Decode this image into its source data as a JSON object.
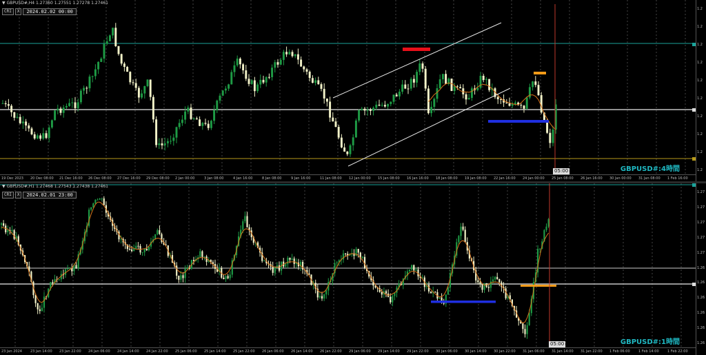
{
  "top": {
    "header": "GBPUSD#,H4  1.27360 1.27551 1.27278 1.27461",
    "dt_btn1": "CRI",
    "dt_btn2": "X",
    "datetime": "2024.02.02 00:00",
    "watermark": "GBPUSD#:4時間",
    "time_label": "05:00",
    "price_labels": [
      "1.2",
      "1.2",
      "1.2",
      "1.2",
      "1.2",
      "1.2",
      "1.2",
      "1.2",
      "1.2",
      "1.2"
    ],
    "time_axis": [
      "19 Dec 2023",
      "20 Dec 08:00",
      "21 Dec 16:00",
      "26 Dec 08:00",
      "27 Dec 16:00",
      "29 Dec 08:00",
      "2 Jan 00:00",
      "3 Jan 08:00",
      "4 Jan 16:00",
      "8 Jan 08:00",
      "9 Jan 16:00",
      "11 Jan 08:00",
      "12 Jan 00:00",
      "15 Jan 08:00",
      "16 Jan 16:00",
      "18 Jan 08:00",
      "19 Jan 08:00",
      "22 Jan 16:00",
      "24 Jan 00:00",
      "25 Jan 08:00",
      "26 Jan 16:00",
      "30 Jan 00:00",
      "31 Jan 08:00",
      "1 Feb 16:00"
    ]
  },
  "bottom": {
    "header": "GBPUSD#,H1  1.27468 1.27543 1.27438 1.27461",
    "dt_btn1": "CRI",
    "dt_btn2": "X",
    "datetime": "2024.02.01 23:00",
    "watermark": "GBPUSD#:1時間",
    "time_label": "05:00",
    "price_labels": [
      "1.27",
      "1.27",
      "1.27",
      "1.27",
      "1.27",
      "1.26",
      "1.26",
      "1.26",
      "1.26",
      "1.26",
      "1.26"
    ],
    "time_axis": [
      "23 Jan 2024",
      "23 Jan 14:00",
      "23 Jan 22:00",
      "24 Jan 06:00",
      "24 Jan 14:00",
      "24 Jan 22:00",
      "25 Jan 06:00",
      "25 Jan 14:00",
      "25 Jan 22:00",
      "26 Jan 06:00",
      "26 Jan 14:00",
      "26 Jan 22:00",
      "29 Jan 06:00",
      "29 Jan 14:00",
      "29 Jan 22:00",
      "30 Jan 06:00",
      "30 Jan 14:00",
      "30 Jan 22:00",
      "31 Jan 06:00",
      "31 Jan 14:00",
      "31 Jan 22:00",
      "1 Feb 06:00",
      "1 Feb 14:00",
      "1 Feb 22:00"
    ]
  },
  "colors": {
    "bull": "#1e9b45",
    "bear": "#f2f2c8",
    "ma": "#d8731a",
    "channel": "#e6e6e6",
    "cyan_line": "#1aa39a",
    "yellow_line": "#b79a1a",
    "red_zone": "#e8101a",
    "blue_zone": "#1f2fe0",
    "orange_zone": "#f29a18",
    "vline": "#c0392b"
  }
}
